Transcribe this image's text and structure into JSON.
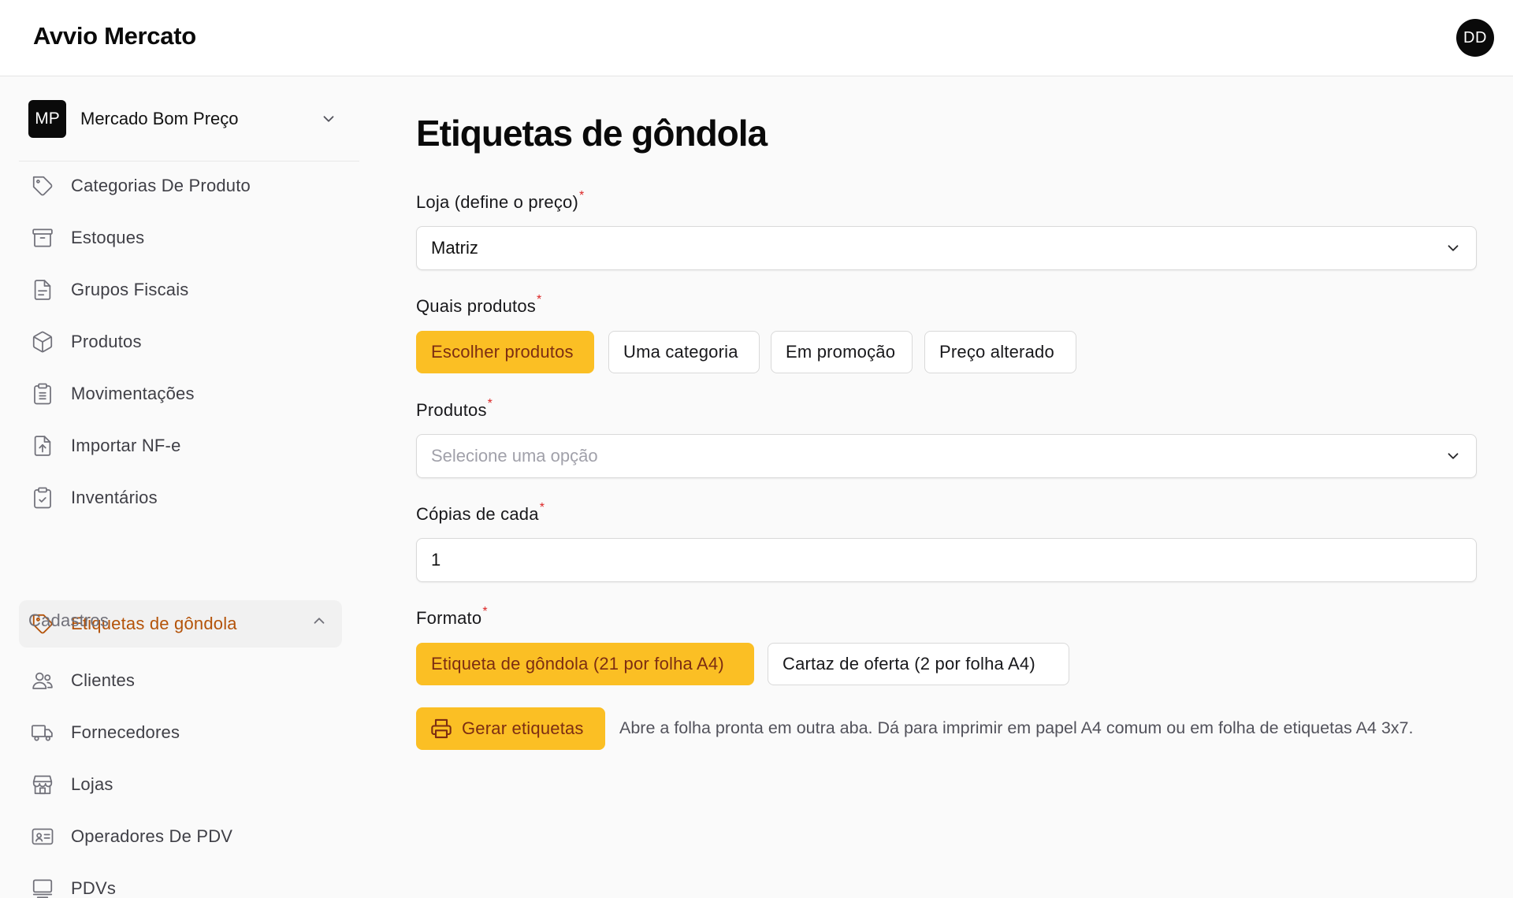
{
  "app": {
    "brand": "Avvio Mercato",
    "user_initials": "DD"
  },
  "sidebar": {
    "store": {
      "initials": "MP",
      "name": "Mercado Bom Preço"
    },
    "items": [
      {
        "label": "Categorias De Produto",
        "icon": "tag-icon"
      },
      {
        "label": "Estoques",
        "icon": "archive-icon"
      },
      {
        "label": "Grupos Fiscais",
        "icon": "document-icon"
      },
      {
        "label": "Produtos",
        "icon": "box-icon"
      },
      {
        "label": "Movimentações",
        "icon": "clipboard-list-icon"
      },
      {
        "label": "Importar NF-e",
        "icon": "file-upload-icon"
      },
      {
        "label": "Inventários",
        "icon": "clipboard-check-icon"
      },
      {
        "label": "Etiquetas de gôndola",
        "icon": "tag-icon",
        "active": true
      }
    ],
    "section": {
      "label": "Cadastros",
      "expanded": true
    },
    "section_items": [
      {
        "label": "Clientes",
        "icon": "users-icon"
      },
      {
        "label": "Fornecedores",
        "icon": "truck-icon"
      },
      {
        "label": "Lojas",
        "icon": "store-icon"
      },
      {
        "label": "Operadores De PDV",
        "icon": "id-card-icon"
      },
      {
        "label": "PDVs",
        "icon": "monitor-icon"
      }
    ]
  },
  "main": {
    "title": "Etiquetas de gôndola",
    "store_field": {
      "label": "Loja (define o preço)",
      "required_mark": "*",
      "value": "Matriz"
    },
    "which_products": {
      "label": "Quais produtos",
      "required_mark": "*",
      "options": [
        "Escolher produtos",
        "Uma categoria",
        "Em promoção",
        "Preço alterado"
      ],
      "selected": "Escolher produtos"
    },
    "products_field": {
      "label": "Produtos",
      "required_mark": "*",
      "placeholder": "Selecione uma opção"
    },
    "copies_field": {
      "label": "Cópias de cada",
      "required_mark": "*",
      "value": "1"
    },
    "format": {
      "label": "Formato",
      "required_mark": "*",
      "options": [
        "Etiqueta de gôndola (21 por folha A4)",
        "Cartaz de oferta (2 por folha A4)"
      ],
      "selected": "Etiqueta de gôndola (21 por folha A4)"
    },
    "generate_button": {
      "label": "Gerar etiquetas",
      "icon": "printer-icon"
    },
    "help_text": "Abre a folha pronta em outra aba. Dá para imprimir em papel A4 comum ou em folha de etiquetas A4 3x7."
  },
  "colors": {
    "accent": "#fbbf24",
    "accent_text": "#7c2d12",
    "active_nav_text": "#b45309",
    "required": "#dc2626"
  }
}
